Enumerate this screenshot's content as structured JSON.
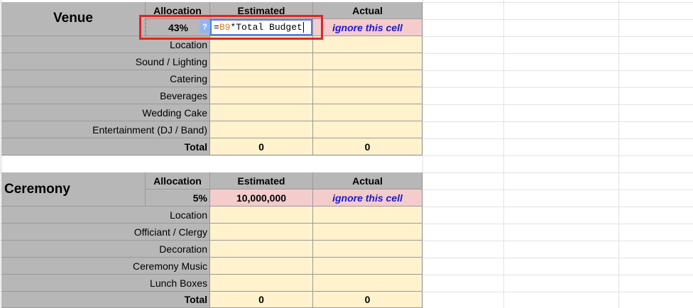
{
  "venue": {
    "title": "Venue",
    "headers": {
      "allocation": "Allocation",
      "estimated": "Estimated",
      "actual": "Actual"
    },
    "allocation_value": "43%",
    "formula": {
      "prefix": "=",
      "ref": "B9",
      "rest": "*Total Budget"
    },
    "help_label": "?",
    "actual_note": "ignore this cell",
    "items": [
      "Location",
      "Sound / Lighting",
      "Catering",
      "Beverages",
      "Wedding Cake",
      "Entertainment (DJ / Band)"
    ],
    "total_label": "Total",
    "total_estimated": "0",
    "total_actual": "0"
  },
  "ceremony": {
    "title": "Ceremony",
    "headers": {
      "allocation": "Allocation",
      "estimated": "Estimated",
      "actual": "Actual"
    },
    "allocation_value": "5%",
    "estimated_value": "10,000,000",
    "actual_note": "ignore this cell",
    "items": [
      "Location",
      "Officiant / Clergy",
      "Decoration",
      "Ceremony Music",
      "Lunch Boxes"
    ],
    "total_label": "Total",
    "total_estimated": "0",
    "total_actual": "0"
  }
}
